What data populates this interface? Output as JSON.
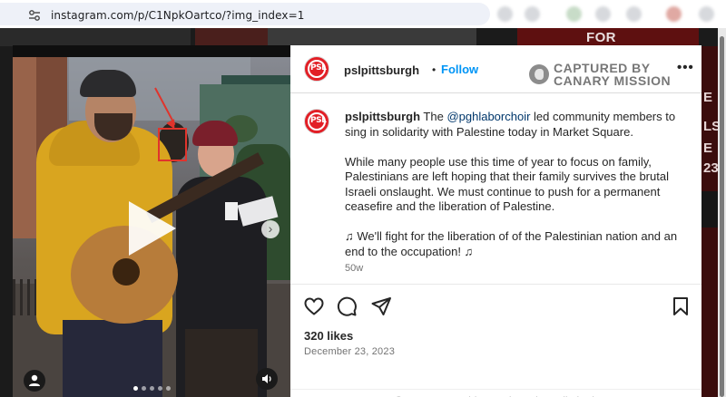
{
  "browser": {
    "url": "instagram.com/p/C1NpkOartco/?img_index=1"
  },
  "backdrop": {
    "banner_text": "FOR PALESTINE",
    "side_letters": [
      "E",
      "LS",
      "E",
      "23"
    ]
  },
  "post": {
    "author": "pslpittsburgh",
    "avatar_text": "PSL",
    "separator": "•",
    "follow_label": "Follow",
    "overlay_line1": "CAPTURED BY",
    "overlay_line2": "CANARY MISSION",
    "more_label": "•••",
    "caption": {
      "author": "pslpittsburgh",
      "pre_mention": " The ",
      "mention": "@pghlaborchoir",
      "post_mention": " led community members to sing in solidarity with Palestine today in Market Square.",
      "paragraph2": "While many people use this time of year to focus on family, Palestinians are left hoping that their family survives the brutal Israeli onslaught. We must continue to push for a permanent ceasefire and the liberation of Palestine.",
      "paragraph3": "♫ We'll fight for the liberation of of the Palestinian nation and an end to the occupation! ♫"
    },
    "age": "50w",
    "likes": "320 likes",
    "date": "December 23, 2023",
    "comments_notice": "Comments on this post have been limited."
  },
  "media": {
    "slide_count": 5,
    "active_slide": 1,
    "next_label": "›"
  },
  "colors": {
    "follow_blue": "#0095f6",
    "psl_red": "#e21f26",
    "annotation_red": "#e0342c"
  }
}
